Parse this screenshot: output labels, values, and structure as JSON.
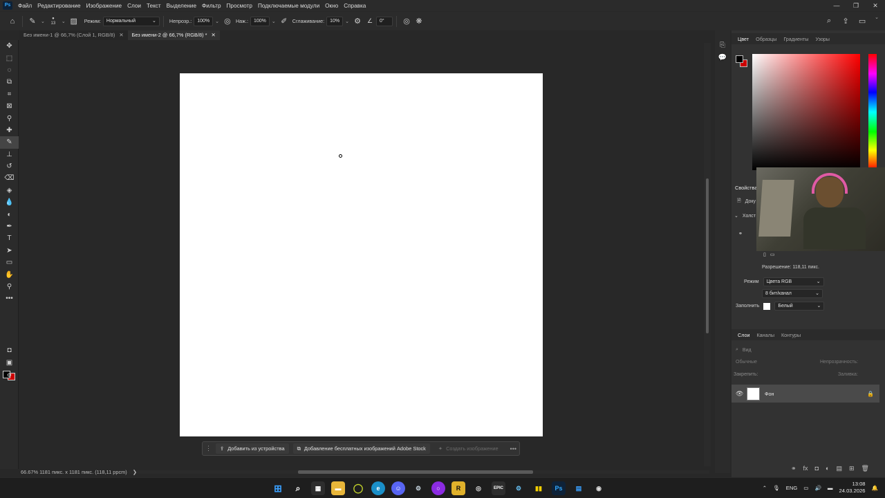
{
  "app": {
    "logo_text": "Ps"
  },
  "menu": [
    "Файл",
    "Редактирование",
    "Изображение",
    "Слои",
    "Текст",
    "Выделение",
    "Фильтр",
    "Просмотр",
    "Подключаемые модули",
    "Окно",
    "Справка"
  ],
  "window_controls": {
    "minimize": "—",
    "restore": "❐",
    "close": "✕"
  },
  "options": {
    "brush_size": "13",
    "mode_label": "Режим:",
    "mode_value": "Нормальный",
    "opacity_label": "Непрозр.:",
    "opacity_value": "100%",
    "pressure_label": "Наж.:",
    "pressure_value": "100%",
    "smoothing_label": "Сглаживание:",
    "smoothing_value": "10%",
    "angle_value": "0°"
  },
  "tabs": [
    {
      "label": "Без имени-1 @ 66,7% (Слой 1, RGB/8)",
      "close": "✕",
      "active": false
    },
    {
      "label": "Без имени-2 @ 66,7% (RGB/8) *",
      "close": "✕",
      "active": true
    }
  ],
  "context_bar": {
    "add_from_device": "Добавить из устройства",
    "add_stock": "Добавление бесплатных изображений Adobe Stock",
    "generate_image": "Создать изображение",
    "more": "•••"
  },
  "status": {
    "zoom": "66.67%",
    "doc_info": "1181 пикс. x 1181 пикс. (118,11 ppcm)",
    "arrow": "❯"
  },
  "color_panel": {
    "tabs": [
      "Цвет",
      "Образцы",
      "Градиенты",
      "Узоры"
    ],
    "fg_color": "#000000",
    "bg_color": "#cc0000"
  },
  "properties": {
    "header": "Свойства",
    "doc_label": "Доку",
    "canvas_label": "Холст",
    "resolution": "Разрешение: 118,11 пикс.",
    "mode_label": "Режим",
    "mode_value": "Цвета RGB",
    "depth_value": "8 бит/канал",
    "fill_label": "Заполнить",
    "fill_value": "Белый"
  },
  "layers": {
    "tabs": [
      "Слои",
      "Каналы",
      "Контуры"
    ],
    "search_placeholder": "Вид",
    "blend_mode": "Обычные",
    "opacity_label": "Непрозрачность:",
    "lock_label": "Закрепить:",
    "fill_label": "Заливка:",
    "items": [
      {
        "name": "Фон",
        "locked": true,
        "visible": true
      }
    ]
  },
  "taskbar": {
    "lang": "ENG",
    "time": "13:08",
    "date": "24.03.2026"
  }
}
